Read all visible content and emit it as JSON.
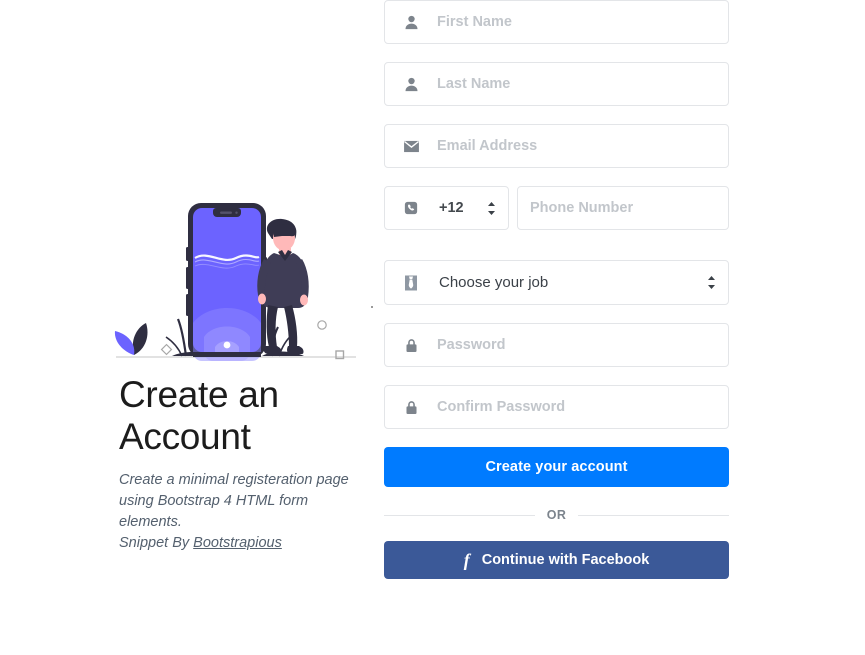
{
  "left": {
    "headline": "Create an Account",
    "description": "Create a minimal registeration page using Bootstrap 4 HTML form elements.",
    "snippet_prefix": "Snippet By ",
    "snippet_link": "Bootstrapious",
    "illustration_name": "person-leaning-on-smartphone-illustration"
  },
  "form": {
    "first_name": {
      "icon": "user-icon",
      "placeholder": "First Name",
      "value": ""
    },
    "last_name": {
      "icon": "user-icon",
      "placeholder": "Last Name",
      "value": ""
    },
    "email": {
      "icon": "envelope-icon",
      "placeholder": "Email Address",
      "value": ""
    },
    "phone": {
      "icon": "phone-icon",
      "country_code_selected": "+12",
      "country_code_options": [
        "+12"
      ],
      "placeholder": "Phone Number",
      "value": ""
    },
    "job": {
      "icon": "necktie-icon",
      "selected": "Choose your job",
      "options": [
        "Choose your job"
      ]
    },
    "password": {
      "icon": "lock-icon",
      "placeholder": "Password",
      "value": ""
    },
    "confirm_password": {
      "icon": "lock-icon",
      "placeholder": "Confirm Password",
      "value": ""
    },
    "submit_label": "Create your account",
    "divider_label": "OR",
    "facebook_label": "Continue with Facebook",
    "facebook_glyph": "f"
  },
  "colors": {
    "primary_button": "#007bff",
    "facebook_button": "#3b5998",
    "illustration_purple": "#6c63ff",
    "illustration_dark": "#2f2e41",
    "input_border": "#e3e5e8",
    "placeholder_text": "#c2c6cb",
    "body_text": "#54606e",
    "headline_text": "#1c1c1c"
  }
}
